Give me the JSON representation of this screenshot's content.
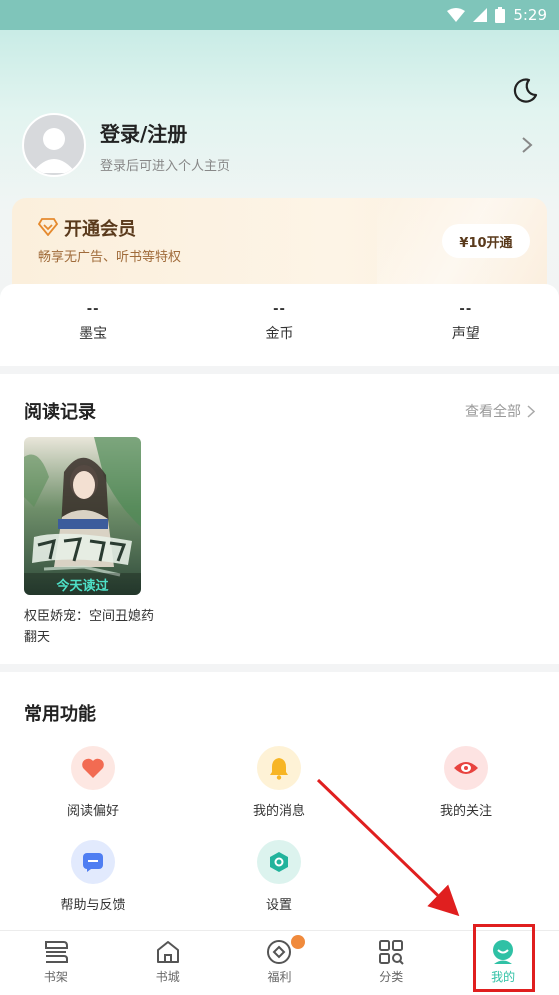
{
  "status_bar": {
    "time": "5:29"
  },
  "profile": {
    "title": "登录/注册",
    "subtitle": "登录后可进入个人主页"
  },
  "vip": {
    "title": "开通会员",
    "subtitle": "畅享无广告、听书等特权",
    "button": "¥10开通"
  },
  "stats": [
    {
      "value": "--",
      "label": "墨宝"
    },
    {
      "value": "--",
      "label": "金币"
    },
    {
      "value": "--",
      "label": "声望"
    }
  ],
  "history": {
    "title": "阅读记录",
    "view_all": "查看全部",
    "book": {
      "cover_badge": "今天读过",
      "title": "权臣娇宠：空间丑媳药翻天"
    }
  },
  "features": {
    "title": "常用功能",
    "items": [
      {
        "label": "阅读偏好",
        "icon": "heart-icon",
        "color": "#f26b52"
      },
      {
        "label": "我的消息",
        "icon": "bell-icon",
        "color": "#f7b524"
      },
      {
        "label": "我的关注",
        "icon": "eye-icon",
        "color": "#e8433f"
      },
      {
        "label": "帮助与反馈",
        "icon": "chat-icon",
        "color": "#4f7ef2"
      },
      {
        "label": "设置",
        "icon": "settings-icon",
        "color": "#22b39c"
      }
    ]
  },
  "tabbar": {
    "items": [
      {
        "label": "书架",
        "icon": "bookshelf-icon"
      },
      {
        "label": "书城",
        "icon": "home-icon"
      },
      {
        "label": "福利",
        "icon": "gift-icon"
      },
      {
        "label": "分类",
        "icon": "category-icon"
      },
      {
        "label": "我的",
        "icon": "profile-icon",
        "active": true
      }
    ]
  },
  "colors": {
    "accent": "#2fc1a5",
    "annotation": "#e01f1f"
  }
}
